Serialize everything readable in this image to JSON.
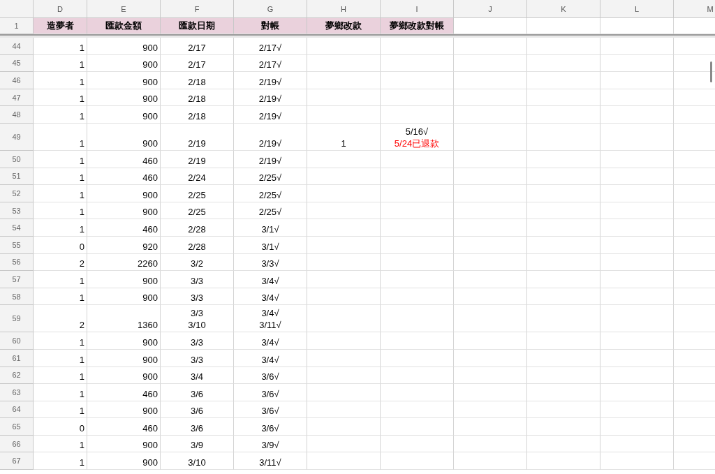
{
  "columns": [
    {
      "letter": "D",
      "title": "造夢者"
    },
    {
      "letter": "E",
      "title": "匯款金額"
    },
    {
      "letter": "F",
      "title": "匯款日期"
    },
    {
      "letter": "G",
      "title": "對帳"
    },
    {
      "letter": "H",
      "title": "夢鄉改款"
    },
    {
      "letter": "I",
      "title": "夢鄉改款對帳"
    },
    {
      "letter": "J"
    },
    {
      "letter": "K"
    },
    {
      "letter": "L"
    },
    {
      "letter": "M"
    }
  ],
  "header_row": "1",
  "rows": [
    {
      "row": "44",
      "cells": [
        [
          "1"
        ],
        [
          "900"
        ],
        [
          "2/17"
        ],
        [
          "2/17√"
        ],
        null,
        null
      ]
    },
    {
      "row": "45",
      "cells": [
        [
          "1"
        ],
        [
          "900"
        ],
        [
          "2/17"
        ],
        [
          "2/17√"
        ],
        null,
        null
      ]
    },
    {
      "row": "46",
      "cells": [
        [
          "1"
        ],
        [
          "900"
        ],
        [
          "2/18"
        ],
        [
          "2/19√"
        ],
        null,
        null
      ]
    },
    {
      "row": "47",
      "cells": [
        [
          "1"
        ],
        [
          "900"
        ],
        [
          "2/18"
        ],
        [
          "2/19√"
        ],
        null,
        null
      ]
    },
    {
      "row": "48",
      "cells": [
        [
          "1"
        ],
        [
          "900"
        ],
        [
          "2/18"
        ],
        [
          "2/19√"
        ],
        null,
        null
      ]
    },
    {
      "row": "49",
      "cells": [
        [
          "1"
        ],
        [
          "900"
        ],
        [
          "2/19"
        ],
        [
          "2/19√"
        ],
        [
          "1"
        ],
        [
          "5/16√",
          {
            "text": "5/24已退款",
            "color": "#ff0000"
          }
        ]
      ]
    },
    {
      "row": "50",
      "cells": [
        [
          "1"
        ],
        [
          "460"
        ],
        [
          "2/19"
        ],
        [
          "2/19√"
        ],
        null,
        null
      ]
    },
    {
      "row": "51",
      "cells": [
        [
          "1"
        ],
        [
          "460"
        ],
        [
          "2/24"
        ],
        [
          "2/25√"
        ],
        null,
        null
      ]
    },
    {
      "row": "52",
      "cells": [
        [
          "1"
        ],
        [
          "900"
        ],
        [
          "2/25"
        ],
        [
          "2/25√"
        ],
        null,
        null
      ]
    },
    {
      "row": "53",
      "cells": [
        [
          "1"
        ],
        [
          "900"
        ],
        [
          "2/25"
        ],
        [
          "2/25√"
        ],
        null,
        null
      ]
    },
    {
      "row": "54",
      "cells": [
        [
          "1"
        ],
        [
          "460"
        ],
        [
          "2/28"
        ],
        [
          "3/1√"
        ],
        null,
        null
      ]
    },
    {
      "row": "55",
      "cells": [
        [
          "0"
        ],
        [
          "920"
        ],
        [
          "2/28"
        ],
        [
          "3/1√"
        ],
        null,
        null
      ]
    },
    {
      "row": "56",
      "cells": [
        [
          "2"
        ],
        [
          "2260"
        ],
        [
          "3/2"
        ],
        [
          "3/3√"
        ],
        null,
        null
      ]
    },
    {
      "row": "57",
      "cells": [
        [
          "1"
        ],
        [
          "900"
        ],
        [
          "3/3"
        ],
        [
          "3/4√"
        ],
        null,
        null
      ]
    },
    {
      "row": "58",
      "cells": [
        [
          "1"
        ],
        [
          "900"
        ],
        [
          "3/3"
        ],
        [
          "3/4√"
        ],
        null,
        null
      ]
    },
    {
      "row": "59",
      "cells": [
        [
          "2"
        ],
        [
          "1360"
        ],
        [
          "3/3",
          "3/10"
        ],
        [
          "3/4√",
          "3/11√"
        ],
        null,
        null
      ]
    },
    {
      "row": "60",
      "cells": [
        [
          "1"
        ],
        [
          "900"
        ],
        [
          "3/3"
        ],
        [
          "3/4√"
        ],
        null,
        null
      ]
    },
    {
      "row": "61",
      "cells": [
        [
          "1"
        ],
        [
          "900"
        ],
        [
          "3/3"
        ],
        [
          "3/4√"
        ],
        null,
        null
      ]
    },
    {
      "row": "62",
      "cells": [
        [
          "1"
        ],
        [
          "900"
        ],
        [
          "3/4"
        ],
        [
          "3/6√"
        ],
        null,
        null
      ]
    },
    {
      "row": "63",
      "cells": [
        [
          "1"
        ],
        [
          "460"
        ],
        [
          "3/6"
        ],
        [
          "3/6√"
        ],
        null,
        null
      ]
    },
    {
      "row": "64",
      "cells": [
        [
          "1"
        ],
        [
          "900"
        ],
        [
          "3/6"
        ],
        [
          "3/6√"
        ],
        null,
        null
      ]
    },
    {
      "row": "65",
      "cells": [
        [
          "0"
        ],
        [
          "460"
        ],
        [
          "3/6"
        ],
        [
          "3/6√"
        ],
        null,
        null
      ]
    },
    {
      "row": "66",
      "cells": [
        [
          "1"
        ],
        [
          "900"
        ],
        [
          "3/9"
        ],
        [
          "3/9√"
        ],
        null,
        null
      ]
    },
    {
      "row": "67",
      "cells": [
        [
          "1"
        ],
        [
          "900"
        ],
        [
          "3/10"
        ],
        [
          "3/11√"
        ],
        null,
        null
      ]
    }
  ]
}
